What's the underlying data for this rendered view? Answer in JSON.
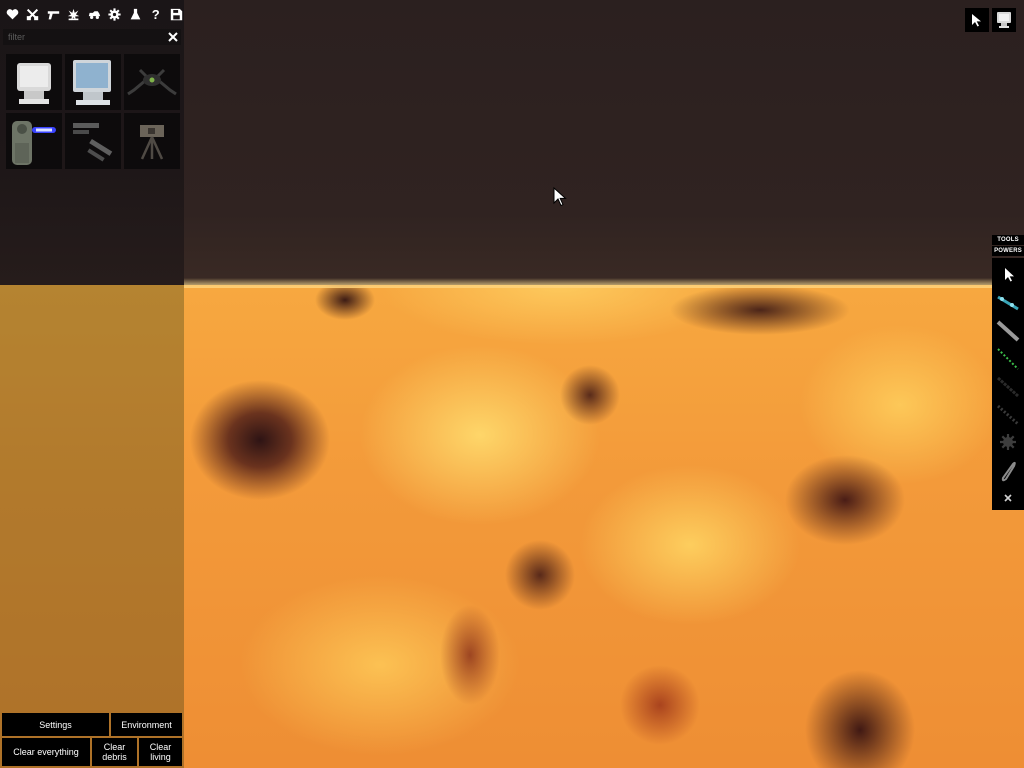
{
  "toolbar": {
    "buttons": [
      {
        "name": "favourites",
        "icon": "heart-icon"
      },
      {
        "name": "melee",
        "icon": "crossed-swords-icon"
      },
      {
        "name": "firearms",
        "icon": "gun-icon"
      },
      {
        "name": "explosives",
        "icon": "explosion-icon"
      },
      {
        "name": "vehicles",
        "icon": "car-icon"
      },
      {
        "name": "machinery",
        "icon": "gear-icon"
      },
      {
        "name": "chemistry",
        "icon": "flask-icon"
      },
      {
        "name": "help",
        "icon": "question-icon",
        "glyph": "?"
      },
      {
        "name": "save",
        "icon": "save-icon"
      }
    ]
  },
  "filter": {
    "placeholder": "filter",
    "value": "",
    "clear_glyph": "✕"
  },
  "catalog": {
    "items": [
      {
        "icon": "white-monitor-icon"
      },
      {
        "icon": "blue-screen-monitor-icon"
      },
      {
        "icon": "dark-spider-machine-icon"
      },
      {
        "icon": "laser-emitter-icon"
      },
      {
        "icon": "metal-rods-icon"
      },
      {
        "icon": "tripod-camera-icon"
      }
    ]
  },
  "bottom_buttons": {
    "settings": "Settings",
    "environment": "Environment",
    "clear_everything": "Clear everything",
    "clear_debris_line1": "Clear",
    "clear_debris_line2": "debris",
    "clear_living_line1": "Clear",
    "clear_living_line2": "living"
  },
  "top_right": {
    "pointer_icon": "pointer-icon",
    "monitor_icon": "monitor-icon"
  },
  "side_panel": {
    "tabs": {
      "tools": "TOOLS",
      "powers": "POWERS"
    },
    "tools": [
      {
        "icon": "pointer-icon"
      },
      {
        "icon": "drag-chain-icon"
      },
      {
        "icon": "rod-icon"
      },
      {
        "icon": "spring-icon"
      },
      {
        "icon": "cable-icon"
      },
      {
        "icon": "rope-icon"
      },
      {
        "icon": "gear-cog-icon"
      },
      {
        "icon": "hook-icon"
      },
      {
        "icon": "eraser-icon"
      }
    ]
  },
  "colors": {
    "sky": "#2e2220",
    "lava_bright": "#ffd86a",
    "lava_mid": "#f39a3a",
    "lava_dark": "#3a1218",
    "ui_black": "#000000",
    "panel_bg": "#1b1617"
  }
}
